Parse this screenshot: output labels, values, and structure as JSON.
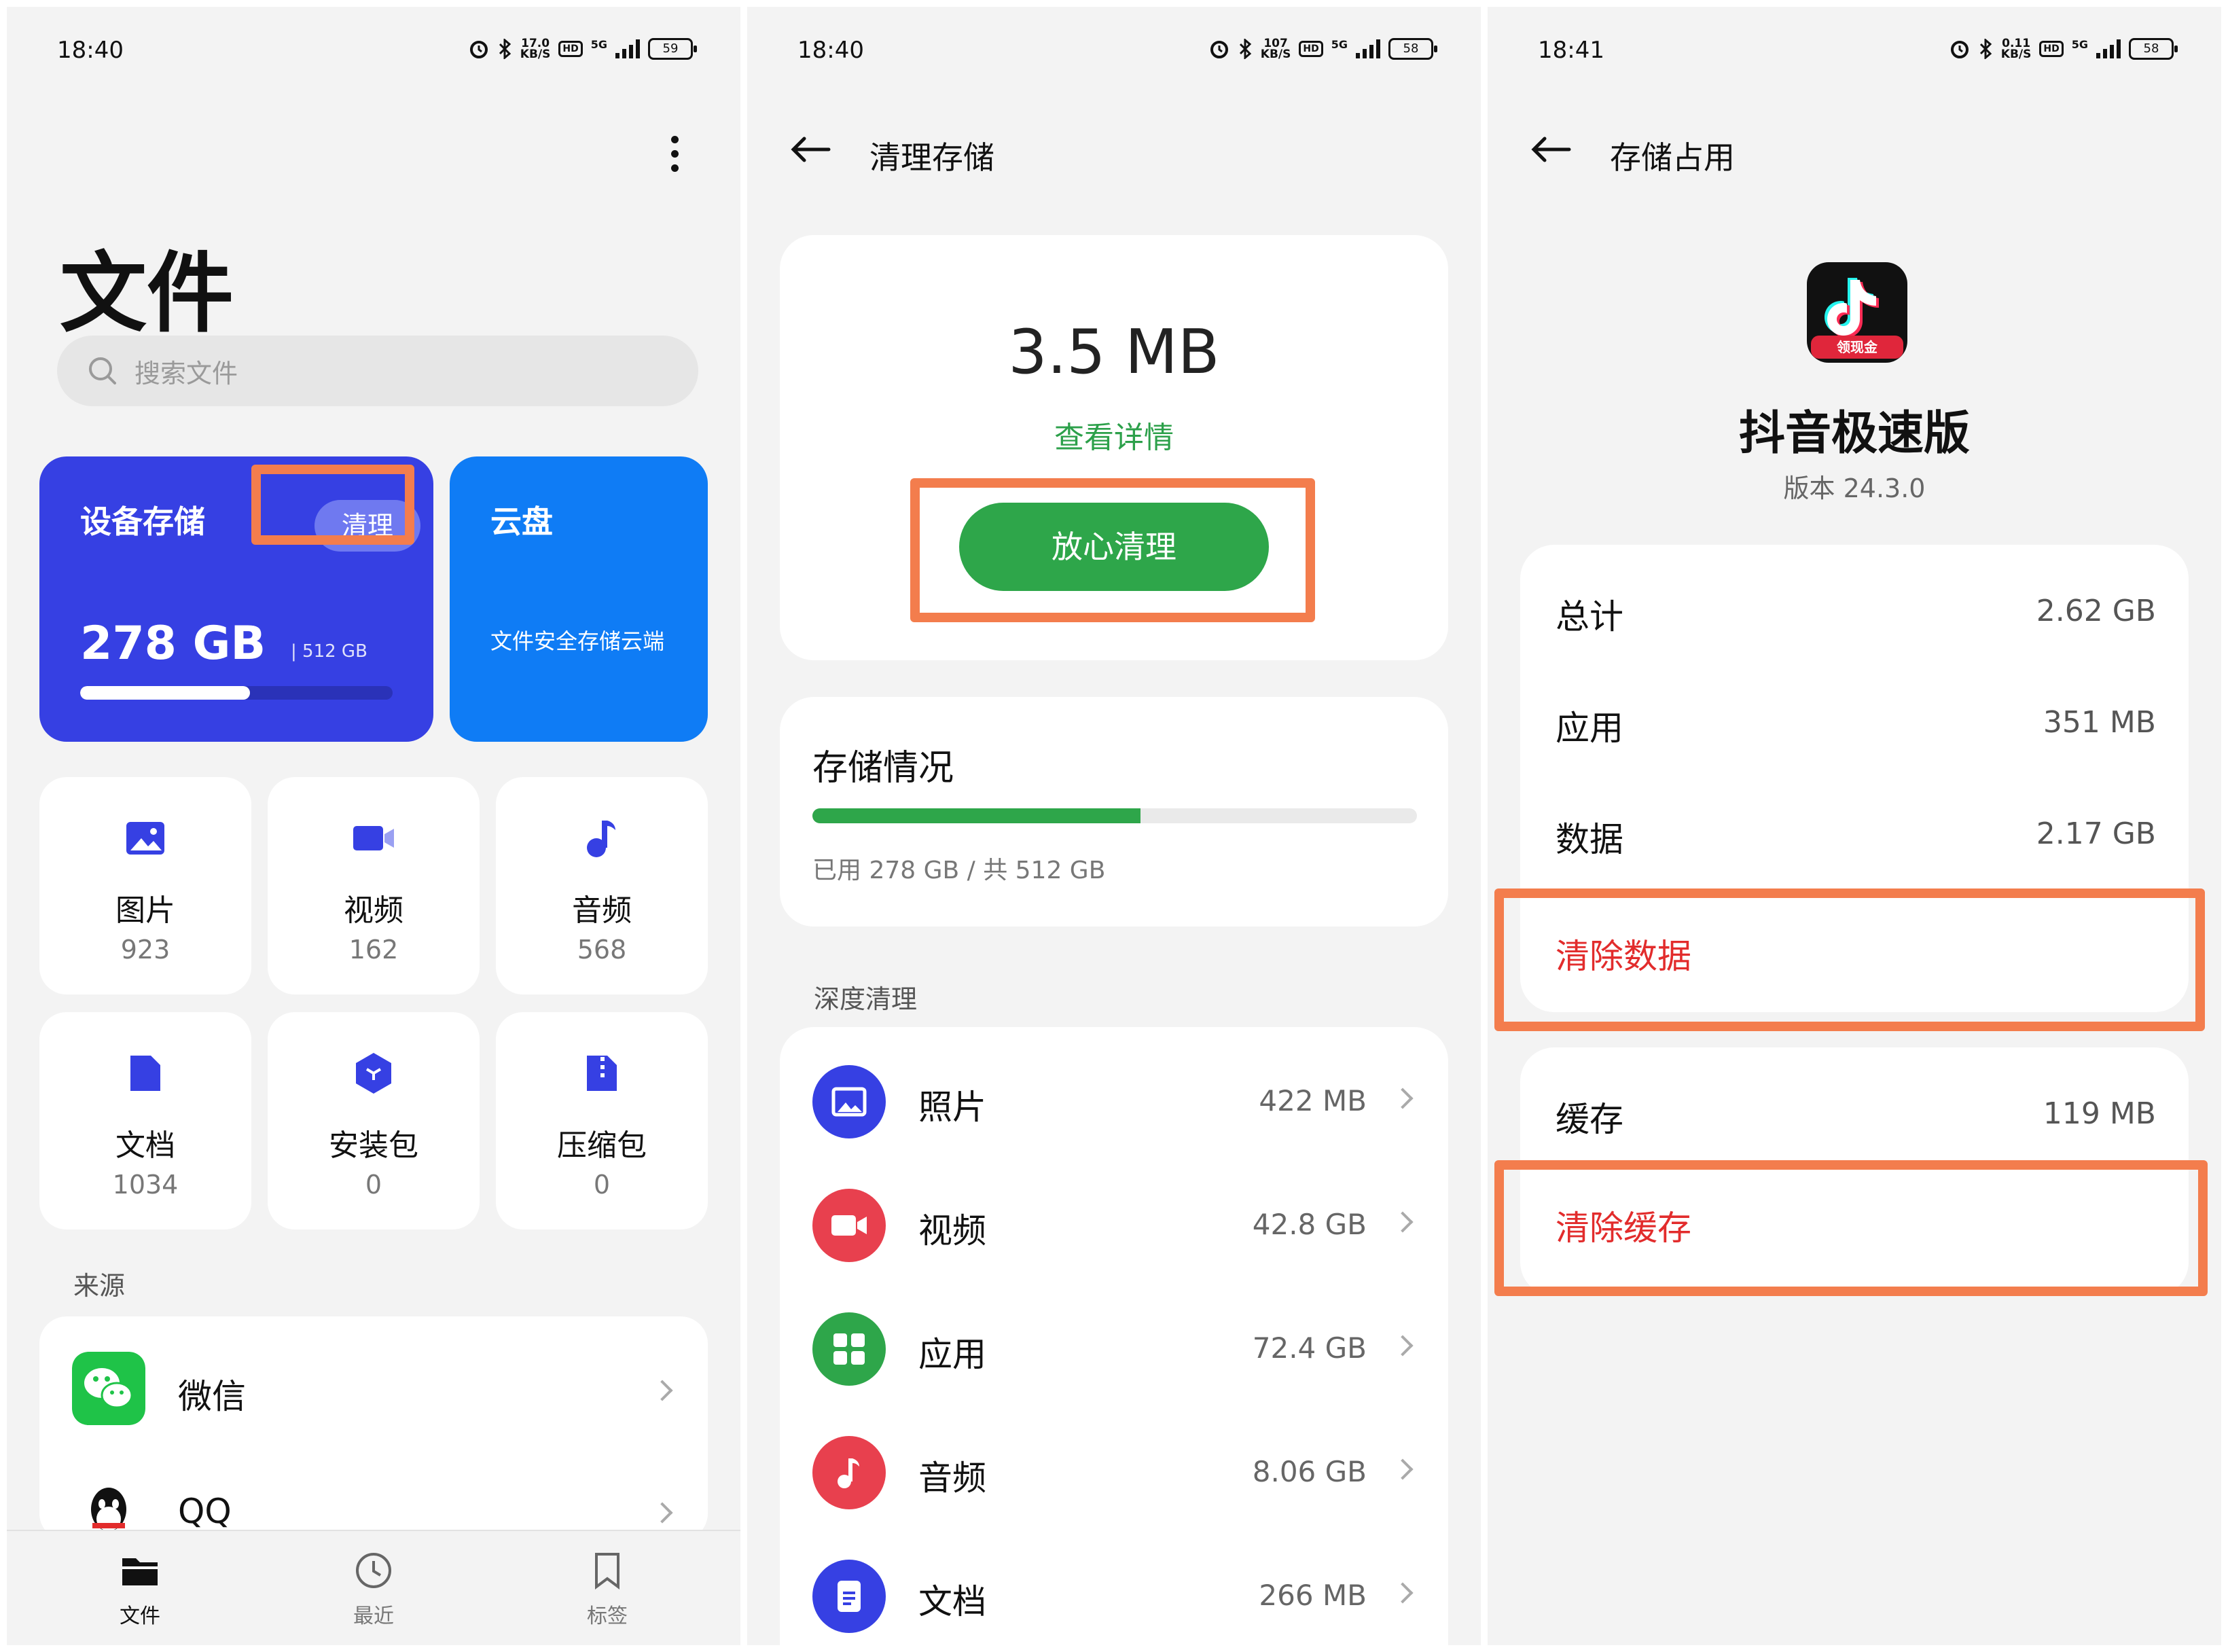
{
  "s1": {
    "status": {
      "time": "18:40",
      "speed_top": "17.0",
      "speed_unit": "KB/S",
      "hd": "HD",
      "net": "5G",
      "battery": "59"
    },
    "title": "文件",
    "search_placeholder": "搜索文件",
    "device": {
      "title": "设备存储",
      "clean_label": "清理",
      "used": "278 GB",
      "total": "| 512 GB",
      "fraction": 0.543
    },
    "cloud": {
      "title": "云盘",
      "desc": "文件安全存储云端"
    },
    "tiles": [
      {
        "label": "图片",
        "count": "923"
      },
      {
        "label": "视频",
        "count": "162"
      },
      {
        "label": "音频",
        "count": "568"
      },
      {
        "label": "文档",
        "count": "1034"
      },
      {
        "label": "安装包",
        "count": "0"
      },
      {
        "label": "压缩包",
        "count": "0"
      }
    ],
    "source_label": "来源",
    "sources": [
      {
        "name": "微信"
      },
      {
        "name": "QQ"
      }
    ],
    "nav": [
      {
        "label": "文件"
      },
      {
        "label": "最近"
      },
      {
        "label": "标签"
      }
    ],
    "accent": "#3640e3"
  },
  "s2": {
    "status": {
      "time": "18:40",
      "speed_top": "107",
      "speed_unit": "KB/S",
      "hd": "HD",
      "net": "5G",
      "battery": "58"
    },
    "title": "清理存储",
    "junk_size": "3.5 MB",
    "detail_link": "查看详情",
    "clean_button": "放心清理",
    "storage": {
      "title": "存储情况",
      "used_text": "已用 278 GB / 共 512 GB",
      "fraction": 0.543
    },
    "deep_label": "深度清理",
    "categories": [
      {
        "name": "照片",
        "size": "422 MB",
        "color": "#3640e3"
      },
      {
        "name": "视频",
        "size": "42.8 GB",
        "color": "#e8404e"
      },
      {
        "name": "应用",
        "size": "72.4 GB",
        "color": "#2ea64a"
      },
      {
        "name": "音频",
        "size": "8.06 GB",
        "color": "#e8404e"
      },
      {
        "name": "文档",
        "size": "266 MB",
        "color": "#3640e3"
      }
    ],
    "accent": "#2ea64a"
  },
  "s3": {
    "status": {
      "time": "18:41",
      "speed_top": "0.11",
      "speed_unit": "KB/S",
      "hd": "HD",
      "net": "5G",
      "battery": "58"
    },
    "title": "存储占用",
    "app_badge": "领现金",
    "app_name": "抖音极速版",
    "version": "版本  24.3.0",
    "rows": [
      {
        "key": "总计",
        "value": "2.62 GB"
      },
      {
        "key": "应用",
        "value": "351 MB"
      },
      {
        "key": "数据",
        "value": "2.17 GB"
      }
    ],
    "clear_data": "清除数据",
    "cache": {
      "key": "缓存",
      "value": "119 MB"
    },
    "clear_cache": "清除缓存",
    "danger_color": "#e22c2c",
    "highlight_color": "#f37d4d"
  }
}
